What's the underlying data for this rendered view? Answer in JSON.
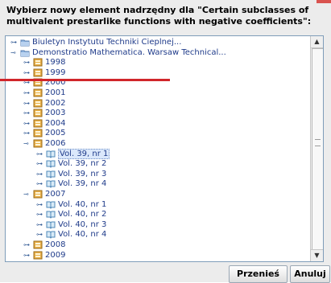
{
  "dialog": {
    "prompt": "Wybierz nowy element nadrzędny dla \"Certain subclasses of multivalent prestarlike functions with negative coefficients\":",
    "buttons": {
      "move": "Przenieś",
      "cancel": "Anuluj"
    }
  },
  "tree": {
    "nodes": [
      {
        "label": "Biuletyn Instytutu Techniki Cieplnej...",
        "level": 0,
        "state": "collapsed",
        "icon": "folder-icon",
        "color": "#ffffff"
      },
      {
        "label": "Demonstratio Mathematica. Warsaw Technical...",
        "level": 0,
        "state": "expanded",
        "icon": "folder-icon"
      },
      {
        "label": "1998",
        "level": 1,
        "state": "collapsed",
        "icon": "year-icon"
      },
      {
        "label": "1999",
        "level": 1,
        "state": "collapsed",
        "icon": "year-icon"
      },
      {
        "label": "2000",
        "level": 1,
        "state": "collapsed",
        "icon": "year-icon"
      },
      {
        "label": "2001",
        "level": 1,
        "state": "collapsed",
        "icon": "year-icon"
      },
      {
        "label": "2002",
        "level": 1,
        "state": "collapsed",
        "icon": "year-icon"
      },
      {
        "label": "2003",
        "level": 1,
        "state": "collapsed",
        "icon": "year-icon"
      },
      {
        "label": "2004",
        "level": 1,
        "state": "collapsed",
        "icon": "year-icon"
      },
      {
        "label": "2005",
        "level": 1,
        "state": "collapsed",
        "icon": "year-icon"
      },
      {
        "label": "2006",
        "level": 1,
        "state": "expanded",
        "icon": "year-icon"
      },
      {
        "label": "Vol. 39, nr 1",
        "level": 2,
        "state": "collapsed",
        "icon": "book-icon",
        "selected": true
      },
      {
        "label": "Vol. 39, nr 2",
        "level": 2,
        "state": "collapsed",
        "icon": "book-icon"
      },
      {
        "label": "Vol. 39, nr 3",
        "level": 2,
        "state": "collapsed",
        "icon": "book-icon"
      },
      {
        "label": "Vol. 39, nr 4",
        "level": 2,
        "state": "collapsed",
        "icon": "book-icon"
      },
      {
        "label": "2007",
        "level": 1,
        "state": "expanded",
        "icon": "year-icon"
      },
      {
        "label": "Vol. 40, nr 1",
        "level": 2,
        "state": "collapsed",
        "icon": "book-icon"
      },
      {
        "label": "Vol. 40, nr 2",
        "level": 2,
        "state": "collapsed",
        "icon": "book-icon"
      },
      {
        "label": "Vol. 40, nr 3",
        "level": 2,
        "state": "collapsed",
        "icon": "book-icon"
      },
      {
        "label": "Vol. 40, nr 4",
        "level": 2,
        "state": "collapsed",
        "icon": "book-icon"
      },
      {
        "label": "2008",
        "level": 1,
        "state": "collapsed",
        "icon": "year-icon"
      },
      {
        "label": "2009",
        "level": 1,
        "state": "collapsed",
        "icon": "year-icon"
      }
    ]
  },
  "colors": {
    "selection": "#dbe8fb",
    "link_text": "#1f3b8a",
    "overlay_line": "#d1262b",
    "dialog_background": "#ececec"
  }
}
